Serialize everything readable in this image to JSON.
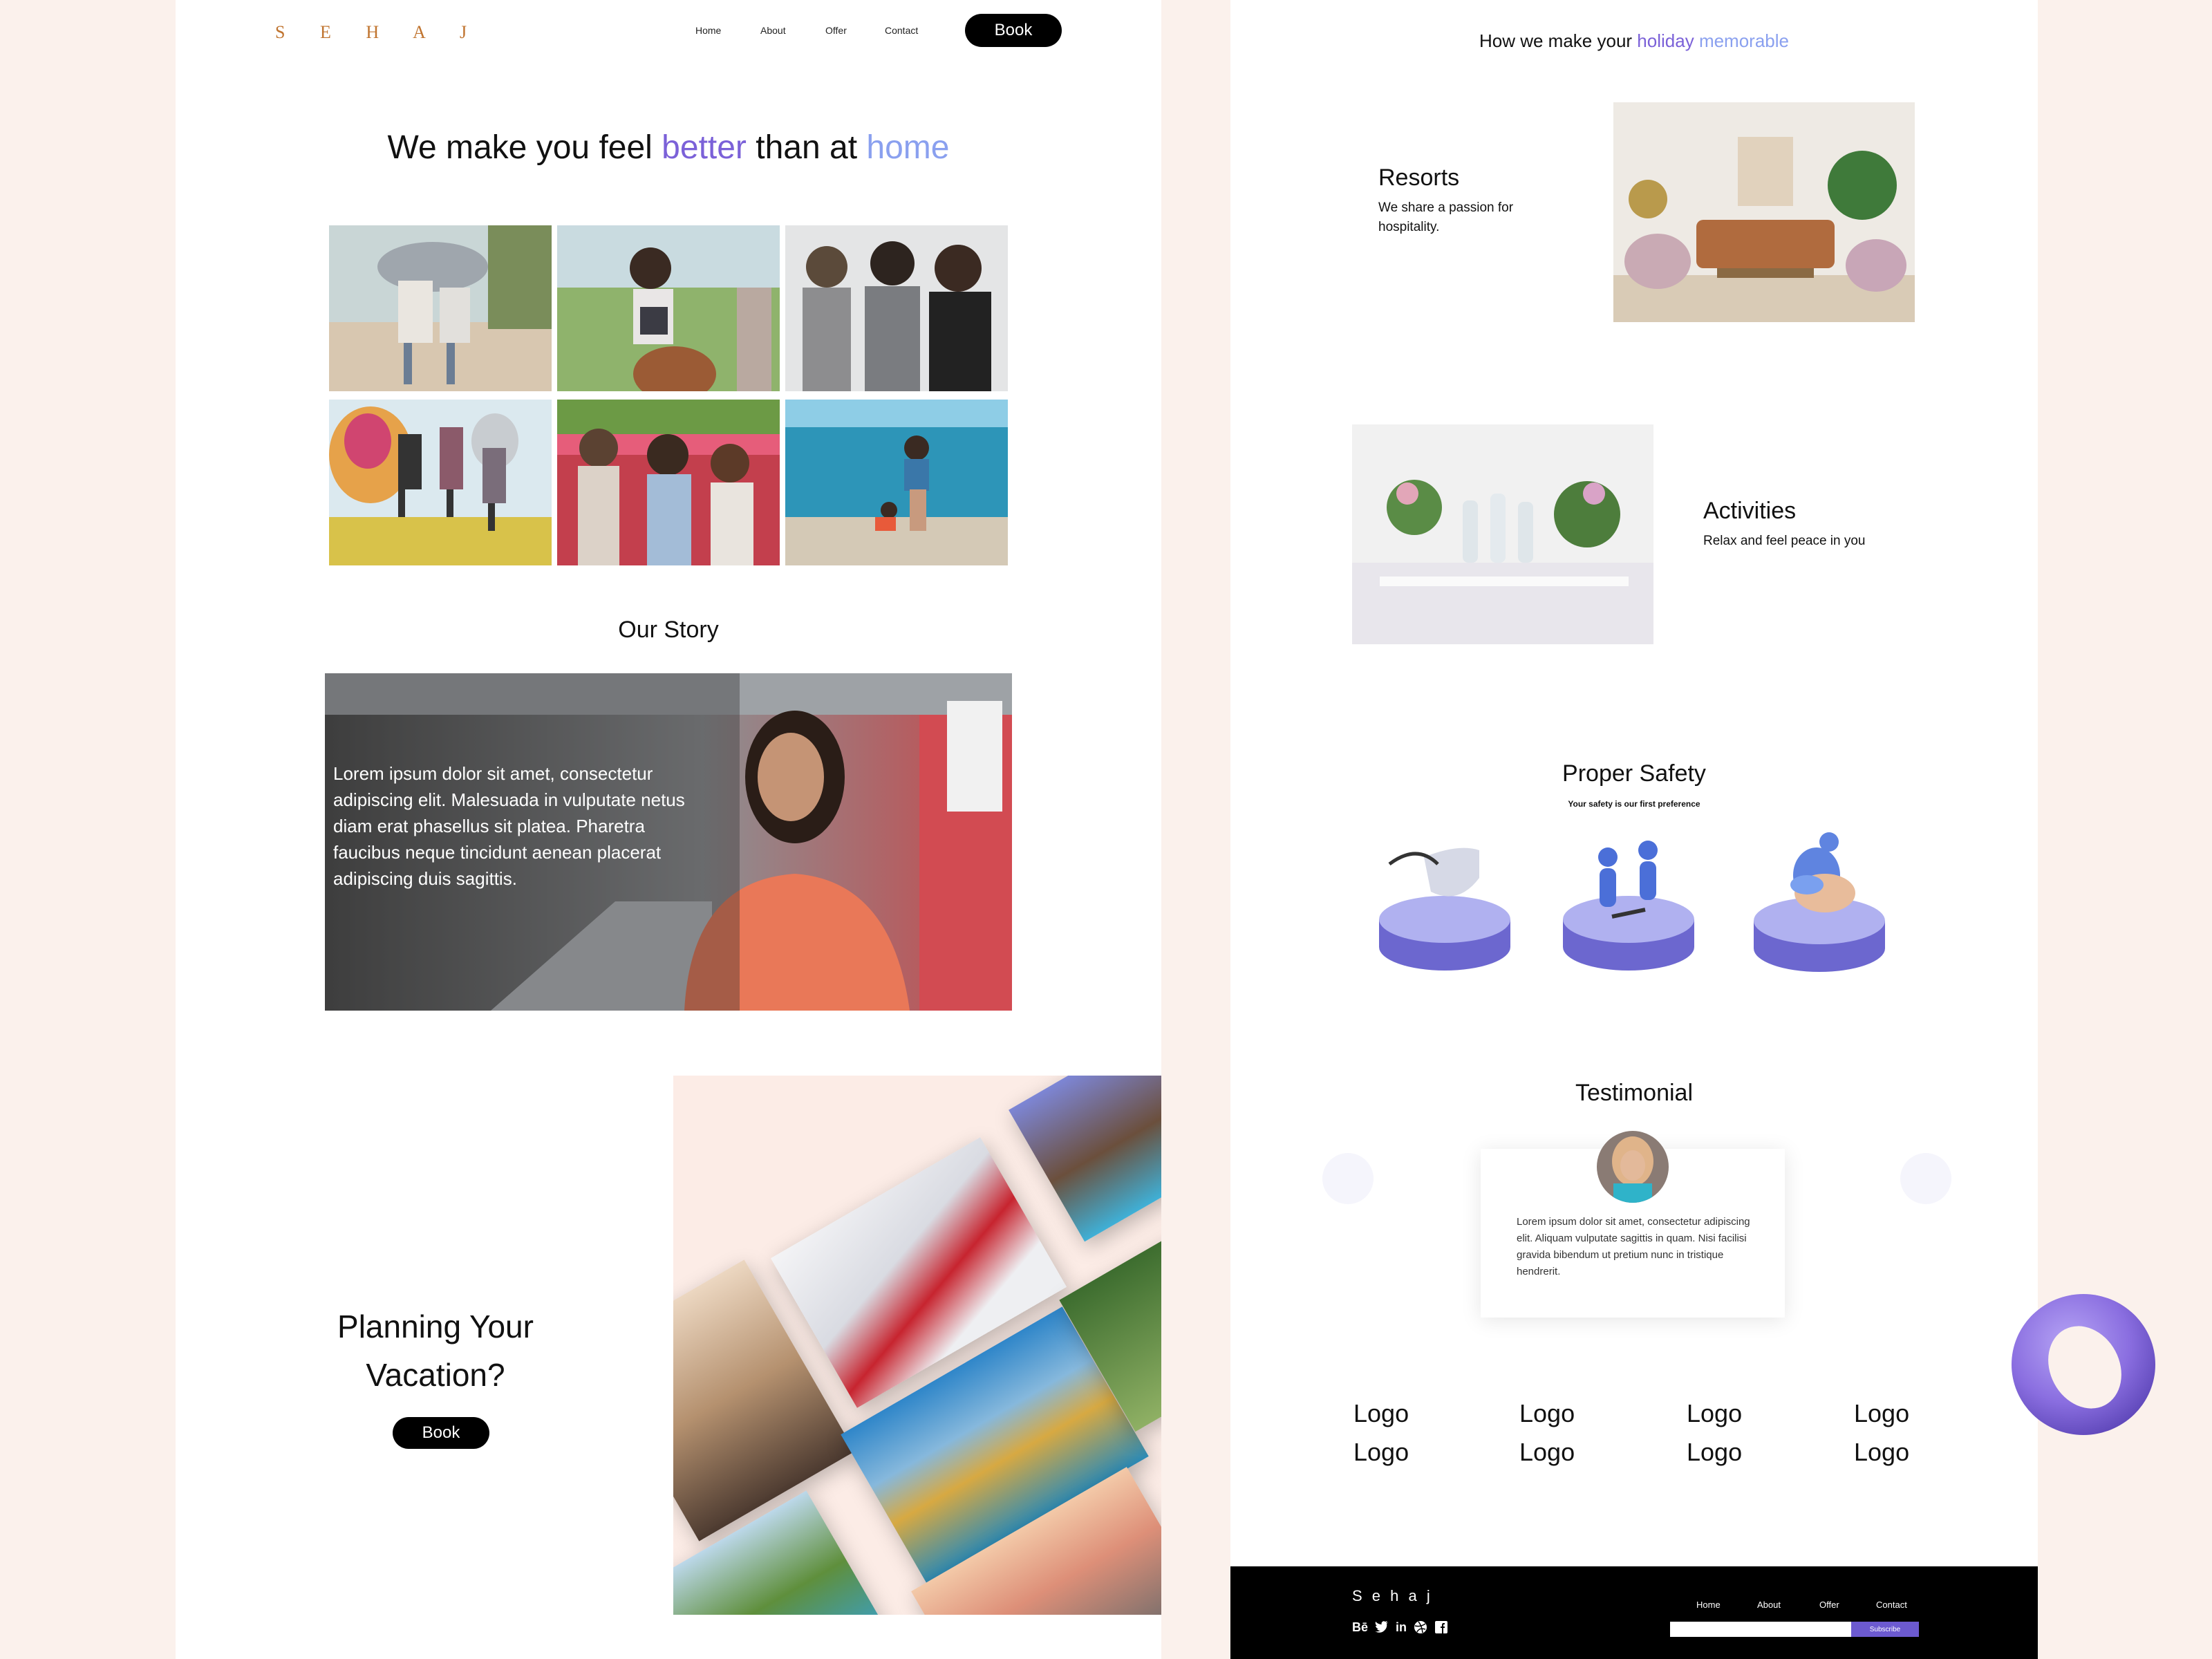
{
  "brand": {
    "name": "S E H A J"
  },
  "nav": {
    "home": "Home",
    "about": "About",
    "offer": "Offer",
    "contact": "Contact",
    "book": "Book"
  },
  "hero": {
    "title_part1": "We make you feel ",
    "title_em1": "better",
    "title_part2": " than at ",
    "title_em2": "home"
  },
  "story": {
    "title": "Our Story",
    "body": "Lorem ipsum dolor sit amet, consectetur adipiscing elit. Malesuada in vulputate netus diam erat phasellus sit platea. Pharetra faucibus neque tincidunt aenean placerat adipiscing duis sagittis."
  },
  "planning": {
    "title": "Planning Your Vacation?",
    "button": "Book"
  },
  "features": {
    "heading_part1": "How we make your ",
    "heading_em1": "holiday",
    "heading_em2": "memorable",
    "resorts": {
      "title": "Resorts",
      "subtitle": "We share a passion for hospitality."
    },
    "activities": {
      "title": "Activities",
      "subtitle": "Relax and feel peace in you"
    }
  },
  "safety": {
    "title": "Proper Safety",
    "subtitle": "Your safety is our first preference"
  },
  "testimonial": {
    "title": "Testimonial",
    "quote": "Lorem ipsum dolor sit amet, consectetur adipiscing elit. Aliquam vulputate sagittis in quam. Nisi facilisi gravida bibendum ut pretium nunc in tristique hendrerit."
  },
  "logos": [
    "Logo",
    "Logo",
    "Logo",
    "Logo",
    "Logo",
    "Logo",
    "Logo",
    "Logo"
  ],
  "footer": {
    "brand": "S e h a j",
    "nav": {
      "home": "Home",
      "about": "About",
      "offer": "Offer",
      "contact": "Contact"
    },
    "social": [
      "behance-icon",
      "twitter-icon",
      "linkedin-icon",
      "dribbble-icon",
      "facebook-icon"
    ],
    "behance_label": "Bē",
    "linkedin_label": "in",
    "subscribe": "Subscribe"
  },
  "colors": {
    "accent": "#7b61d8",
    "accent_light": "#8aa0ef",
    "background": "#fbf1ec",
    "footer": "#000000"
  }
}
